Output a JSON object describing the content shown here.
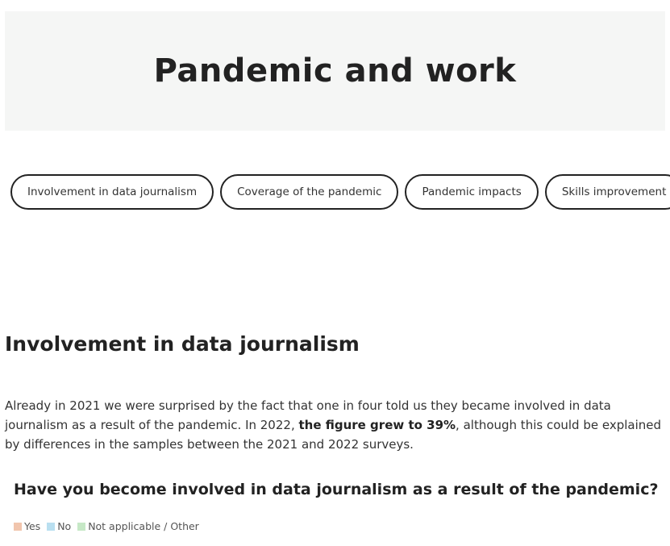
{
  "header": {
    "title": "Pandemic and work"
  },
  "tabs": [
    {
      "label": "Involvement in data journalism"
    },
    {
      "label": "Coverage of the pandemic"
    },
    {
      "label": "Pandemic impacts"
    },
    {
      "label": "Skills improvement"
    }
  ],
  "section": {
    "title": "Involvement in data journalism",
    "paragraph_part1": "Already in 2021 we were surprised by the fact that one in four told us they became involved in data journalism as a result of the pandemic. In 2022, ",
    "paragraph_bold": "the figure grew to 39%",
    "paragraph_part2": ", although this could be explained by differences in the samples between the 2021 and 2022 surveys."
  },
  "chart": {
    "title": "Have you become involved in data journalism as a result of the pandemic?",
    "legend": [
      {
        "label": "Yes",
        "color": "#f1c5ad"
      },
      {
        "label": "No",
        "color": "#b9dff0"
      },
      {
        "label": "Not applicable / Other",
        "color": "#c6e8c6"
      }
    ]
  }
}
